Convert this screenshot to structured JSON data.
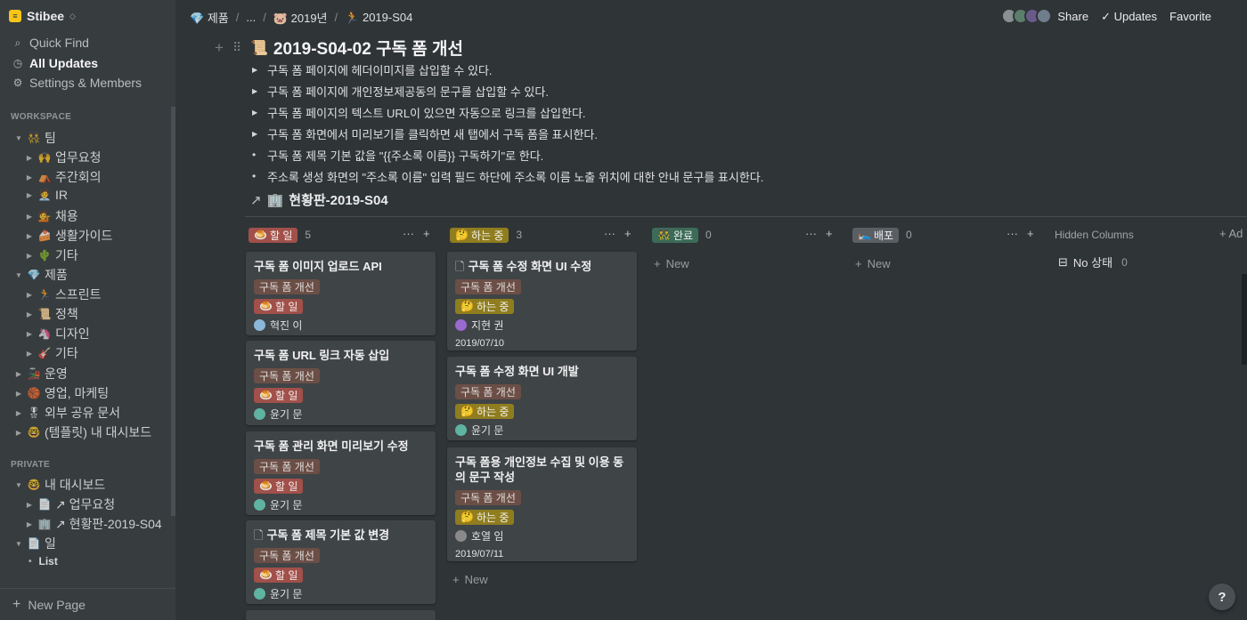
{
  "workspace": {
    "name": "Stibee",
    "chevron": "⌃⌄"
  },
  "sidebar": {
    "links": [
      {
        "label": "Quick Find",
        "icon": "search-icon",
        "glyph": "⌕"
      },
      {
        "label": "All Updates",
        "icon": "clock-icon",
        "glyph": "◷"
      },
      {
        "label": "Settings & Members",
        "icon": "gear-icon",
        "glyph": "⚙"
      }
    ],
    "workspace_label": "WORKSPACE",
    "private_label": "PRIVATE",
    "team": {
      "label": "팀",
      "emoji": "👯"
    },
    "team_children": [
      {
        "label": "업무요청",
        "emoji": "🙌"
      },
      {
        "label": "주간회의",
        "emoji": "⛺"
      },
      {
        "label": "IR",
        "emoji": "🧑‍💼"
      },
      {
        "label": "채용",
        "emoji": "💁"
      },
      {
        "label": "생활가이드",
        "emoji": "🍰"
      },
      {
        "label": "기타",
        "emoji": "🌵"
      }
    ],
    "product": {
      "label": "제품",
      "emoji": "💎"
    },
    "product_children": [
      {
        "label": "스프린트",
        "emoji": "🏃"
      },
      {
        "label": "정책",
        "emoji": "📜"
      },
      {
        "label": "디자인",
        "emoji": "🦄"
      },
      {
        "label": "기타",
        "emoji": "🎸"
      }
    ],
    "top_others": [
      {
        "label": "운영",
        "emoji": "🚂"
      },
      {
        "label": "영업, 마케팅",
        "emoji": "🏀"
      },
      {
        "label": "외부 공유 문서",
        "emoji": "🎖"
      },
      {
        "label": "(템플릿) 내 대시보드",
        "emoji": "🤓"
      }
    ],
    "my_dash": {
      "label": "내 대시보드",
      "emoji": "🤓"
    },
    "my_dash_children": [
      {
        "label": "↗ 업무요청",
        "emoji": "📄"
      },
      {
        "label": "↗ 현황판-2019-S04",
        "emoji": "🏢"
      }
    ],
    "il": {
      "label": "일",
      "emoji": "📄"
    },
    "il_child": {
      "label": "List"
    },
    "new_page": "New Page"
  },
  "breadcrumb": [
    {
      "label": "제품",
      "emoji": "💎"
    },
    {
      "label": "..."
    },
    {
      "label": "2019년",
      "emoji": "🐷"
    },
    {
      "label": "2019-S04",
      "emoji": "🏃"
    }
  ],
  "topbar": {
    "share": "Share",
    "updates": "Updates",
    "updates_check": "✓",
    "favorite": "Favorite",
    "avatar_colors": [
      "#8a8f93",
      "#5b7f6a",
      "#6a5a8a",
      "#6f7e8c"
    ]
  },
  "page": {
    "emoji": "📜",
    "title": "2019-S04-02 구독 폼 개선",
    "bullets": [
      {
        "type": "toggle",
        "text": "구독 폼 페이지에 헤더이미지를 삽입할 수 있다."
      },
      {
        "type": "toggle",
        "text": "구독 폼 페이지에 개인정보제공동의 문구를 삽입할 수 있다."
      },
      {
        "type": "toggle",
        "text": "구독 폼 페이지의 텍스트 URL이 있으면 자동으로 링크를 삽입한다."
      },
      {
        "type": "toggle",
        "text": "구독 폼 화면에서 미리보기를 클릭하면 새 탭에서 구독 폼을 표시한다."
      },
      {
        "type": "bullet",
        "text": "구독 폼 제목 기본 값을 \"{{주소록 이름}} 구독하기\"로 한다."
      },
      {
        "type": "bullet",
        "text": "주소록 생성 화면의 \"주소록 이름\" 입력 필드 하단에 주소록 이름 노출 위치에 대한 안내 문구를 표시한다."
      }
    ],
    "linked_db": {
      "arrow": "↗",
      "emoji": "🏢",
      "title": "현황판-2019-S04"
    }
  },
  "board": {
    "columns": [
      {
        "label": "할 일",
        "emoji": "🍮",
        "count": "5"
      },
      {
        "label": "하는 중",
        "emoji": "🤔",
        "count": "3"
      },
      {
        "label": "완료",
        "emoji": "👯",
        "count": "0"
      },
      {
        "label": "배포",
        "emoji": "🛌",
        "count": "0"
      }
    ],
    "col_more": "···",
    "col_add": "+",
    "new_label": "New",
    "hidden_columns": "Hidden Columns",
    "hidden_add": "+ Ad",
    "no_status": {
      "label": "No 상태",
      "count": "0",
      "icon": "inbox-icon"
    },
    "project_tag": "구독 폼 개선",
    "todo_tag": "할 일",
    "doing_tag": "하는 중",
    "todo_cards": [
      {
        "title": "구독 폼 이미지 업로드 API",
        "person": "혁진 이",
        "av": "#8bb8d8"
      },
      {
        "title": "구독 폼 URL 링크 자동 삽입",
        "person": "윤기 문",
        "av": "#5fb3a1"
      },
      {
        "title": "구독 폼 관리 화면 미리보기 수정",
        "person": "윤기 문",
        "av": "#5fb3a1"
      },
      {
        "title": "구독 폼 제목 기본 값 변경",
        "person": "윤기 문",
        "av": "#5fb3a1",
        "doc": true
      }
    ],
    "doing_cards": [
      {
        "title": "구독 폼 수정 화면 UI 수정",
        "person": "지현 권",
        "av": "#9a6ad0",
        "date": "2019/07/10",
        "doc": true
      },
      {
        "title": "구독 폼 수정 화면 UI 개발",
        "person": "윤기 문",
        "av": "#5fb3a1"
      },
      {
        "title": "구독 폼용 개인정보 수집 및 이용 동의 문구 작성",
        "person": "호열 임",
        "av": "#8a8a8a",
        "date": "2019/07/11"
      }
    ]
  },
  "help": "?"
}
